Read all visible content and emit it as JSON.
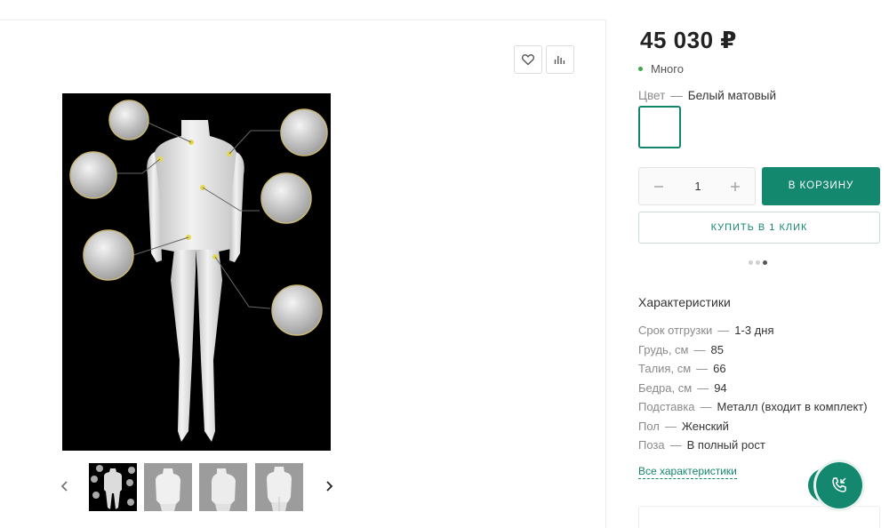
{
  "gallery": {
    "favorite_icon": "heart-icon",
    "compare_icon": "bar-chart-icon",
    "prev_icon": "chevron-left-icon",
    "next_icon": "chevron-right-icon",
    "thumbnail_count": 4,
    "active_thumbnail": 1
  },
  "product": {
    "price": "45 030 ₽",
    "stock_text": "Много",
    "stock_color": "#3aa84a",
    "color_label": "Цвет",
    "color_separator": "—",
    "color_value": "Белый матовый",
    "swatch_color": "#ffffff"
  },
  "buy": {
    "quantity": "1",
    "minus_icon": "minus-icon",
    "plus_icon": "plus-icon",
    "cart_label": "В КОРЗИНУ",
    "one_click_label": "КУПИТЬ В 1 КЛИК",
    "slider_dots": 3,
    "active_dot": 3
  },
  "specs": {
    "title": "Характеристики",
    "separator": "—",
    "rows": [
      {
        "label": "Срок отгрузки",
        "value": "1-3 дня"
      },
      {
        "label": "Грудь, см",
        "value": "85"
      },
      {
        "label": "Талия, см",
        "value": "66"
      },
      {
        "label": "Бедра, см",
        "value": "94"
      },
      {
        "label": "Подставка",
        "value": "Металл (входит в комплект)"
      },
      {
        "label": "Пол",
        "value": "Женский"
      },
      {
        "label": "Поза",
        "value": "В полный рост"
      }
    ],
    "all_link": "Все характеристики"
  },
  "colors": {
    "accent": "#14876f",
    "text": "#333333",
    "muted": "#8a8a8a"
  },
  "call_button": {
    "icon": "phone-icon"
  }
}
